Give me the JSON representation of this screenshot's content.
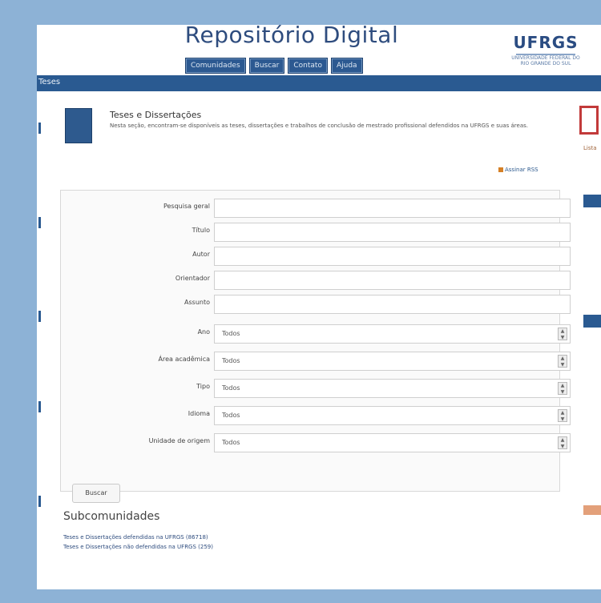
{
  "header": {
    "site_title": "Repositório Digital",
    "nav": [
      "Comunidades",
      "Buscar",
      "Contato",
      "Ajuda"
    ],
    "logo_text": "UFRGS",
    "logo_sub": "UNIVERSIDADE FEDERAL DO RIO GRANDE DO SUL"
  },
  "breadcrumb": "Teses",
  "community": {
    "title": "Teses e Dissertações",
    "description": "Nesta seção, encontram-se disponíveis as teses, dissertações e trabalhos de conclusão de mestrado profissional defendidos na UFRGS e suas áreas.",
    "rss_label": "Assinar RSS"
  },
  "form": {
    "fields": [
      {
        "label": "Pesquisa geral"
      },
      {
        "label": "Título"
      },
      {
        "label": "Autor"
      },
      {
        "label": "Orientador"
      },
      {
        "label": "Assunto"
      }
    ],
    "selects": [
      {
        "label": "Ano",
        "value": "Todos"
      },
      {
        "label": "Área acadêmica",
        "value": "Todos"
      },
      {
        "label": "Tipo",
        "value": "Todos"
      },
      {
        "label": "Idioma",
        "value": "Todos"
      },
      {
        "label": "Unidade de origem",
        "value": "Todos"
      }
    ],
    "button": "Buscar"
  },
  "subcommunities": {
    "title": "Subcomunidades",
    "links": [
      "Teses e Dissertações defendidas na UFRGS (86718)",
      "Teses e Dissertações não defendidas na UFRGS (259)"
    ]
  },
  "sidebar": {
    "text": "Lista"
  },
  "colors": {
    "accent": "#2a5a91",
    "background": "#8db2d6",
    "alert": "#c23a3a"
  }
}
